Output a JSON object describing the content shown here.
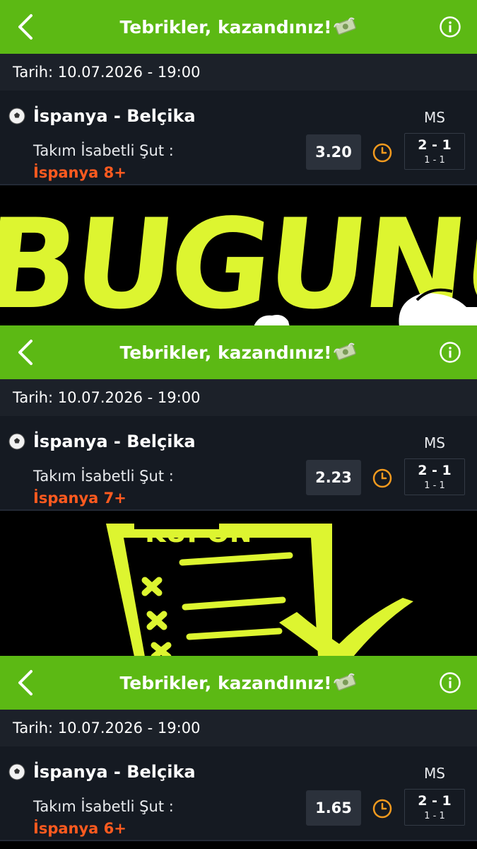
{
  "slips": [
    {
      "header": {
        "title": "Tebrikler, kazandınız!"
      },
      "date": "Tarih: 10.07.2026 - 19:00",
      "match": {
        "teams": "İspanya - Belçika",
        "market": "Takım İsabetli Şut :",
        "pick": "İspanya 8+",
        "odds": "3.20",
        "result_label": "MS",
        "score_ft": "2 - 1",
        "score_ht": "1 - 1"
      }
    },
    {
      "header": {
        "title": "Tebrikler, kazandınız!"
      },
      "date": "Tarih: 10.07.2026 - 19:00",
      "match": {
        "teams": "İspanya - Belçika",
        "market": "Takım İsabetli Şut :",
        "pick": "İspanya 7+",
        "odds": "2.23",
        "result_label": "MS",
        "score_ft": "2 - 1",
        "score_ht": "1 - 1"
      }
    },
    {
      "header": {
        "title": "Tebrikler, kazandınız!"
      },
      "date": "Tarih: 10.07.2026 - 19:00",
      "match": {
        "teams": "İspanya - Belçika",
        "market": "Takım İsabetli Şut :",
        "pick": "İspanya 6+",
        "odds": "1.65",
        "result_label": "MS",
        "score_ft": "2 - 1",
        "score_ht": "1 - 1"
      }
    }
  ],
  "banners": [
    {
      "text": "BUGUNU"
    },
    {
      "text": "KUPON"
    }
  ],
  "colors": {
    "header_green": "#5cb914",
    "pick_orange": "#ff5a1f",
    "clock_orange": "#f39a1e",
    "banner_yellow": "#ddf530"
  },
  "icons": [
    "back-chevron-icon",
    "money-emoji-icon",
    "info-icon",
    "soccer-ball-icon",
    "clock-icon"
  ]
}
